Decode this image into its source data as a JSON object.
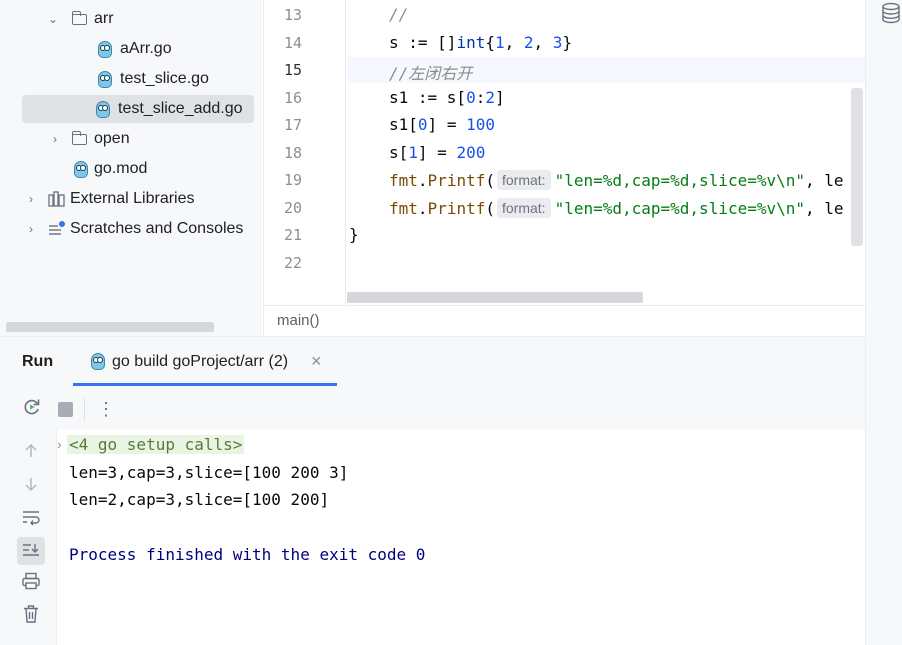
{
  "project_tree": {
    "items": [
      {
        "label": "arr",
        "type": "folder",
        "expanded": true
      },
      {
        "label": "aArr.go",
        "type": "go-file"
      },
      {
        "label": "test_slice.go",
        "type": "go-file"
      },
      {
        "label": "test_slice_add.go",
        "type": "go-file",
        "selected": true
      },
      {
        "label": "open",
        "type": "folder",
        "expanded": false
      },
      {
        "label": "go.mod",
        "type": "go-mod"
      },
      {
        "label": "External Libraries",
        "type": "library"
      },
      {
        "label": "Scratches and Consoles",
        "type": "scratches"
      }
    ]
  },
  "editor": {
    "current_line": "15",
    "lines": [
      {
        "num": "13",
        "comment": "//"
      },
      {
        "num": "14",
        "var": "s",
        "op": " := []",
        "kw": "int",
        "open": "{",
        "n1": "1",
        "sep1": ", ",
        "n2": "2",
        "sep2": ", ",
        "n3": "3",
        "close": "}"
      },
      {
        "num": "15",
        "comment": "//左闭右开"
      },
      {
        "num": "16",
        "text": "s1 := s[",
        "n1": "0",
        "mid": ":",
        "n2": "2",
        "close": "]"
      },
      {
        "num": "17",
        "text": "s1[",
        "n1": "0",
        "mid": "] = ",
        "n2": "100"
      },
      {
        "num": "18",
        "text": "s[",
        "n1": "1",
        "mid": "] = ",
        "n2": "200"
      },
      {
        "num": "19",
        "pkg": "fmt",
        "dot": ".",
        "fn": "Printf",
        "paren": "(",
        "hint": "format:",
        "str": "\"len=%d,cap=%d,slice=%v\\n\"",
        "rest": ", le"
      },
      {
        "num": "20",
        "pkg": "fmt",
        "dot": ".",
        "fn": "Printf",
        "paren": "(",
        "hint": "format:",
        "str": "\"len=%d,cap=%d,slice=%v\\n\"",
        "rest": ", le"
      },
      {
        "num": "21",
        "text": "}"
      },
      {
        "num": "22",
        "text": ""
      }
    ]
  },
  "breadcrumb": "main()",
  "run_panel": {
    "title": "Run",
    "tab_label": "go build goProject/arr (2)",
    "close_glyph": "×",
    "more_glyph": "⋮",
    "output": {
      "setup": "<4 go setup calls>",
      "lines": [
        "len=3,cap=3,slice=[100 200 3]",
        "len=2,cap=3,slice=[100 200]"
      ],
      "finish": "Process finished with the exit code 0"
    }
  },
  "colors": {
    "keyword": "#0033b3",
    "number": "#1750eb",
    "string": "#067d17",
    "comment": "#8c8c8c",
    "finish_text": "#000080",
    "setup_bg": "#e7f5e2",
    "tab_underline": "#3574f0"
  }
}
